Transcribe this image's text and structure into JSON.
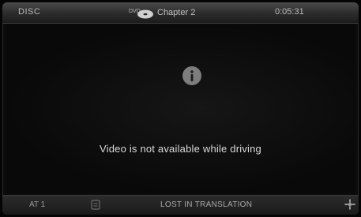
{
  "header": {
    "source": "DISC",
    "chapter": "Chapter 2",
    "time": "0:05:31"
  },
  "screen": {
    "message": "Video is not available while driving"
  },
  "footer": {
    "channel": "AT 1",
    "title": "LOST IN TRANSLATION"
  },
  "icons": {
    "disc": "dvd-disc-icon",
    "info": "info-icon",
    "note": "audio-track-icon",
    "shuffle": "settings-cross-icon"
  }
}
